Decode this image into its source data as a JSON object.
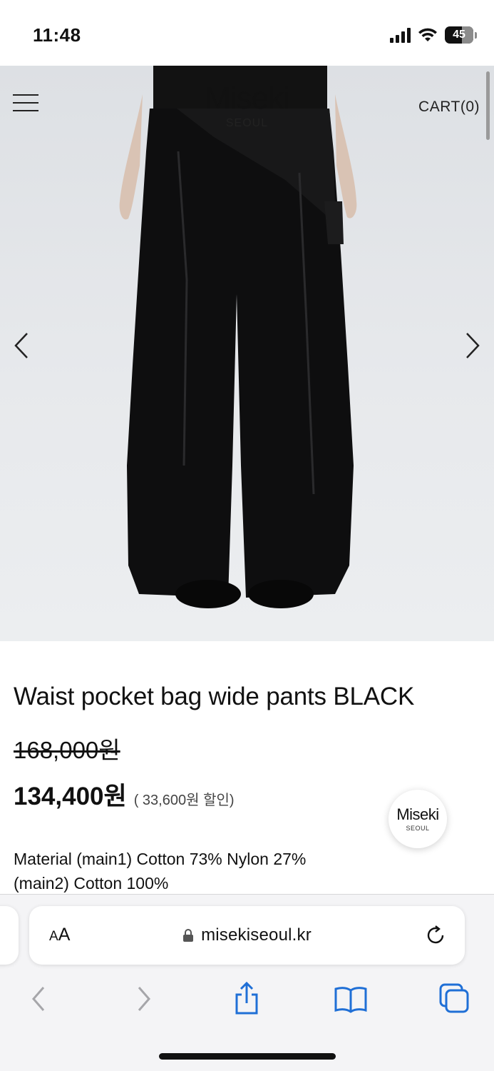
{
  "status_bar": {
    "time": "11:48",
    "battery_level": "45",
    "icons": [
      "cellular-signal-icon",
      "wifi-icon",
      "battery-icon"
    ]
  },
  "header": {
    "brand_name": "Miseki",
    "brand_sub": "SEOUL",
    "cart_label": "CART(0)"
  },
  "gallery": {
    "icons": [
      "hamburger-menu-icon",
      "chevron-left-icon",
      "chevron-right-icon"
    ]
  },
  "product": {
    "title": "Waist pocket bag wide pants BLACK",
    "original_price": "168,000원",
    "sale_price": "134,400원",
    "discount_note": "( 33,600원 할인)",
    "material_line1": "Material (main1) Cotton 73% Nylon 27%",
    "material_line2": "(main2) Cotton 100%"
  },
  "float_badge": {
    "name": "Miseki",
    "sub": "SEOUL"
  },
  "browser": {
    "aa_small": "A",
    "aa_large": "A",
    "url": "misekiseoul.kr",
    "icons": [
      "lock-icon",
      "reload-icon",
      "back-icon",
      "forward-icon",
      "share-icon",
      "bookmarks-icon",
      "tabs-icon"
    ]
  },
  "colors": {
    "accent_blue": "#1f6fd6",
    "disabled_gray": "#a6a6aa",
    "hero_bg": "#e3e5e8"
  }
}
